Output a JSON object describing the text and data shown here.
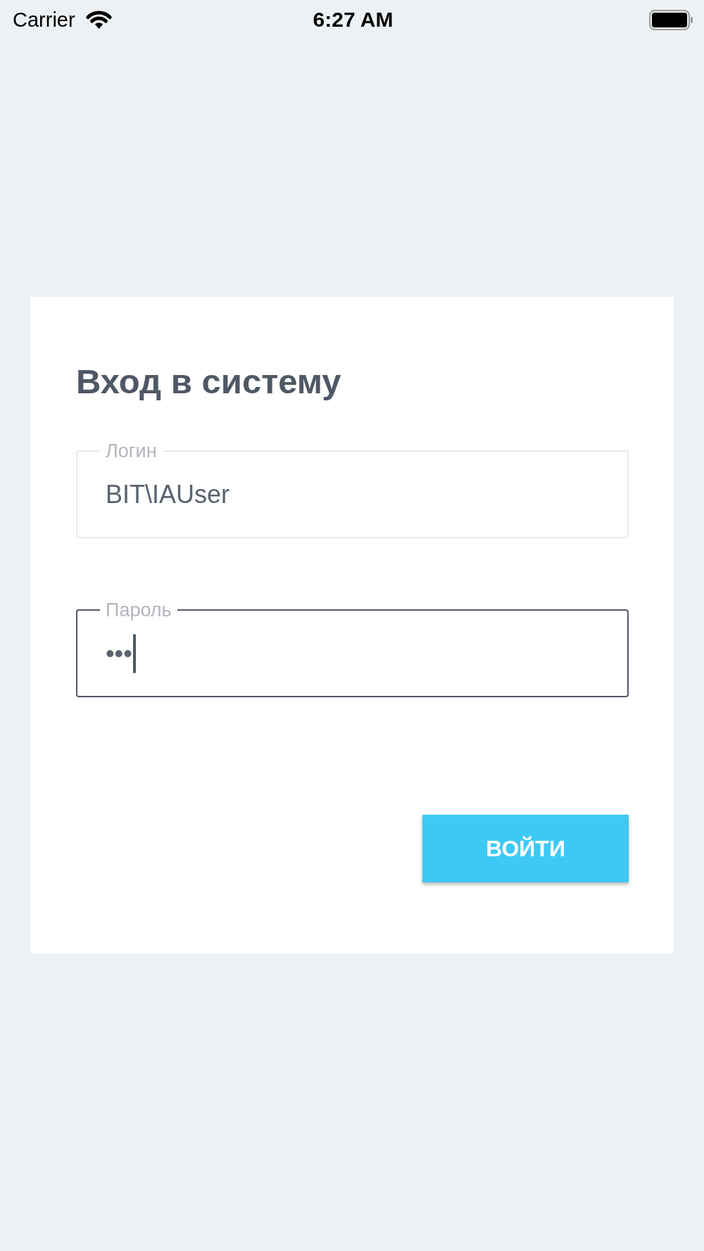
{
  "status_bar": {
    "carrier": "Carrier",
    "time": "6:27 AM"
  },
  "login_form": {
    "title": "Вход в систему",
    "fields": [
      {
        "label": "Логин",
        "value": "BIT\\IAUser",
        "focused": false
      },
      {
        "label": "Пароль",
        "value": "•••",
        "focused": true
      }
    ],
    "submit_button": {
      "label": "ВОЙТИ"
    }
  }
}
